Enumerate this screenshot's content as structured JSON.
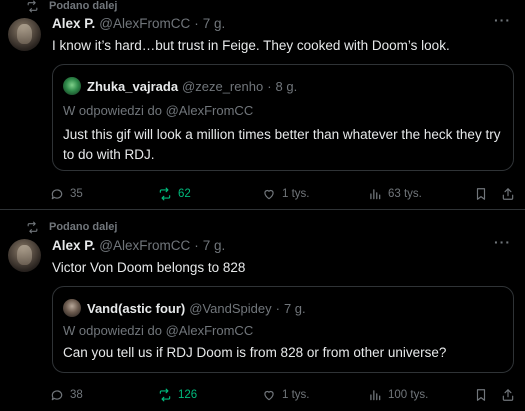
{
  "posts": [
    {
      "repost_label": "Podano dalej",
      "author_name": "Alex P.",
      "author_handle": "@AlexFromCC",
      "separator": "·",
      "time": "7 g.",
      "text": "I know it’s hard…but trust in Feige. They cooked with Doom’s look.",
      "quote": {
        "author_name": "Zhuka_vajrada",
        "author_handle": "@zeze_renho",
        "time": "8 g.",
        "replying_to": "W odpowiedzi do @AlexFromCC",
        "text": "Just this gif will look a million times better than whatever the heck they try to do with RDJ."
      },
      "stats": {
        "replies": "35",
        "reposts": "62",
        "likes": "1 tys.",
        "views": "63 tys."
      }
    },
    {
      "repost_label": "Podano dalej",
      "author_name": "Alex P.",
      "author_handle": "@AlexFromCC",
      "separator": "·",
      "time": "7 g.",
      "text": "Victor Von Doom belongs to 828",
      "quote": {
        "author_name": "Vand(astic four)",
        "author_handle": "@VandSpidey",
        "time": "7 g.",
        "replying_to": "W odpowiedzi do @AlexFromCC",
        "text": "Can you tell us if RDJ Doom is from 828 or from other universe?"
      },
      "stats": {
        "replies": "38",
        "reposts": "126",
        "likes": "1 tys.",
        "views": "100 tys."
      }
    }
  ],
  "more_glyph": "···",
  "colors": {
    "background": "#000000",
    "text": "#e7e9ea",
    "muted": "#71767b",
    "border": "#2f3336",
    "repost_active": "#00ba7c"
  },
  "icons": [
    "repost-icon",
    "reply-icon",
    "like-icon",
    "views-icon",
    "bookmark-icon",
    "share-icon",
    "more-icon"
  ]
}
